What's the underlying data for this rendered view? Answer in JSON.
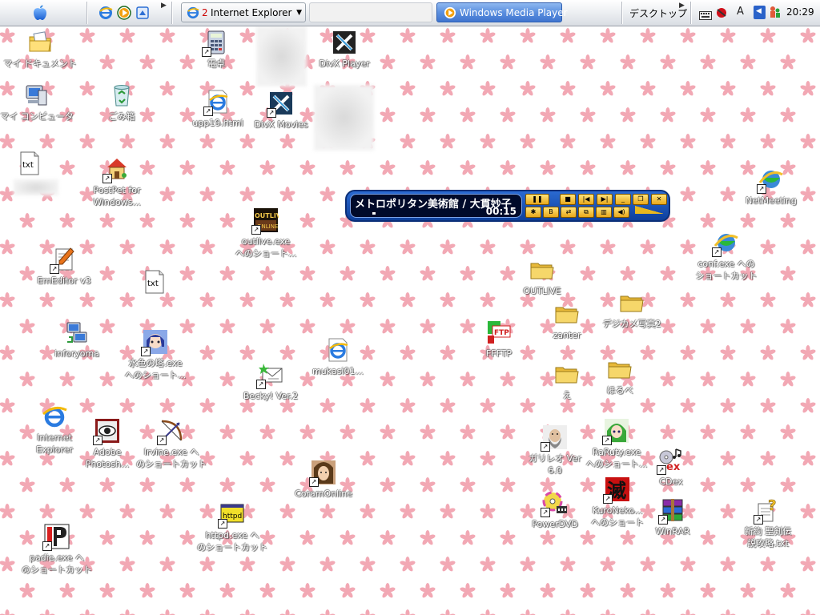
{
  "taskbar": {
    "ie_group_label": "Internet Explorer",
    "ie_group_count": "2",
    "wmp_label": "Windows Media Player",
    "desktop_toolbar_label": "デスクトップ",
    "clock": "20:29",
    "ime_mode": "A"
  },
  "media_player": {
    "track_title": "メトロポリタン美術館 / 大貫妙子",
    "elapsed": "00:15",
    "progress_fraction": 0.02
  },
  "desktop": {
    "icons": [
      {
        "id": "my-documents",
        "label": "マイ ドキュメント",
        "icon": "folder-docs-icon"
      },
      {
        "id": "my-computer",
        "label": "マイ コンピュータ",
        "icon": "computer-icon"
      },
      {
        "id": "recycle-bin",
        "label": "ごみ箱",
        "icon": "recycle-bin-icon"
      },
      {
        "id": "postpet",
        "label": "PostPet for\nWindows...",
        "icon": "postpet-house-icon"
      },
      {
        "id": "calculator",
        "label": "電卓",
        "icon": "calculator-icon"
      },
      {
        "id": "upp-html",
        "label": "upp19.html",
        "icon": "ie-page-icon"
      },
      {
        "id": "divx-player",
        "label": "DivX Player",
        "icon": "divx-icon"
      },
      {
        "id": "divx-movies",
        "label": "DivX Movies",
        "icon": "divx-icon"
      },
      {
        "id": "outlive-exe",
        "label": "outlive.exe\nへのショート...",
        "icon": "outlive-icon"
      },
      {
        "id": "emeditor",
        "label": "EmEditor v3",
        "icon": "emeditor-icon"
      },
      {
        "id": "inforyoma",
        "label": "inforyoma",
        "icon": "network-computer-icon"
      },
      {
        "id": "mizuiro",
        "label": "水色の塔.exe\nへのショート...",
        "icon": "anime-face-icon"
      },
      {
        "id": "becky",
        "label": "Becky! Ver.2",
        "icon": "becky-mail-icon"
      },
      {
        "id": "mukasi",
        "label": "mukasi01...",
        "icon": "ie-page-icon"
      },
      {
        "id": "internet-explorer",
        "label": "Internet\nExplorer",
        "icon": "ie-icon"
      },
      {
        "id": "photoshop",
        "label": "Adobe\nPhotosh...",
        "icon": "photoshop-eye-icon"
      },
      {
        "id": "irvine",
        "label": "Irvine.exe へ\nのショートカット",
        "icon": "irvine-bow-icon"
      },
      {
        "id": "coram",
        "label": "CoramOnline",
        "icon": "coram-face-icon"
      },
      {
        "id": "httpd",
        "label": "httpd.exe へ\nのショートカット",
        "icon": "httpd-icon"
      },
      {
        "id": "padie",
        "label": "padie.exe へ\nのショートカット",
        "icon": "padie-icon"
      },
      {
        "id": "outlive-folder",
        "label": "OUTLIVE",
        "icon": "folder-icon"
      },
      {
        "id": "zanter",
        "label": "zanter",
        "icon": "folder-icon"
      },
      {
        "id": "digicam",
        "label": "デジカメ写真2",
        "icon": "folder-icon"
      },
      {
        "id": "fftp",
        "label": "FFFTP",
        "icon": "ffftp-icon"
      },
      {
        "id": "e-folder",
        "label": "え",
        "icon": "folder-icon"
      },
      {
        "id": "hosoube",
        "label": "ほるべ",
        "icon": "folder-icon"
      },
      {
        "id": "galileo",
        "label": "ガリレオ Ver\n6.0",
        "icon": "galileo-icon"
      },
      {
        "id": "raruty",
        "label": "RaRuty.exe\nへのショート...",
        "icon": "anime-girl-icon"
      },
      {
        "id": "cdex",
        "label": "CDex",
        "icon": "cdex-icon"
      },
      {
        "id": "powerdvd",
        "label": "PowerDVD",
        "icon": "powerdvd-icon"
      },
      {
        "id": "kuroneko",
        "label": "KuroNeko...\nへのショート",
        "icon": "kuroneko-kanji-icon"
      },
      {
        "id": "winrar",
        "label": "WinRAR",
        "icon": "winrar-icon"
      },
      {
        "id": "netmeeting",
        "label": "NetMeeting",
        "icon": "netmeeting-icon"
      },
      {
        "id": "conf-exe",
        "label": "conf.exe への\nショートカット",
        "icon": "netmeeting-icon"
      },
      {
        "id": "seiken",
        "label": "新約 聖剣伝\n説攻略.txt",
        "icon": "help-doc-icon"
      },
      {
        "id": "txt-1",
        "label": "",
        "icon": "txt-icon"
      },
      {
        "id": "txt-2",
        "label": "",
        "icon": "txt-icon"
      }
    ]
  },
  "colors": {
    "desktop_bg": "#ffffff",
    "petal": "#f2a8b4",
    "wmp_blue": "#1f56bd",
    "folder_yellow": "#f3cf4f"
  }
}
